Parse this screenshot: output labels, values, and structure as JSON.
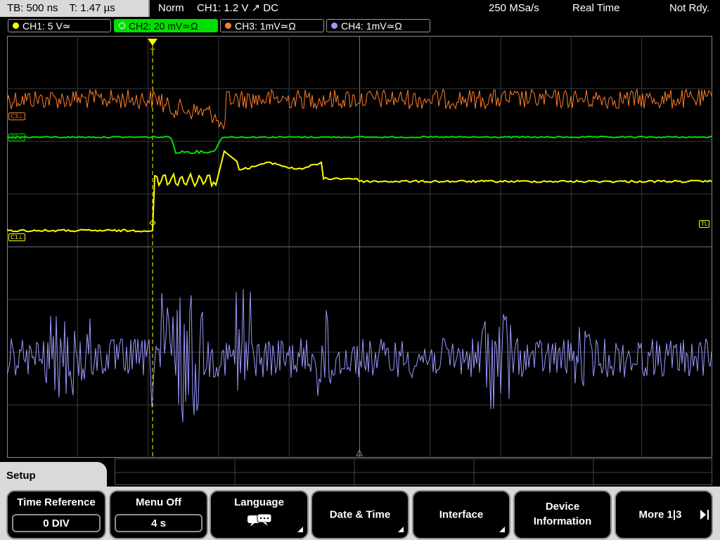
{
  "status": {
    "timebase": "TB: 500 ns",
    "trigger_time": "T: 1.47 µs",
    "mode": "Norm",
    "trigger_info": "CH1: 1.2 V ↗ DC",
    "sample_rate": "250 MSa/s",
    "acq_mode": "Real Time",
    "state": "Not Rdy."
  },
  "channels": [
    {
      "label": "CH1: 5 V≃",
      "color": "#ffff00",
      "active": false
    },
    {
      "label": "CH2: 20 mV≃Ω",
      "color": "#00e000",
      "active": true
    },
    {
      "label": "CH3: 1mV≃Ω",
      "color": "#ff7f27",
      "active": false
    },
    {
      "label": "CH4: 1mV≃Ω",
      "color": "#9999ff",
      "active": false
    }
  ],
  "markers": {
    "c3": "C3⊥",
    "c2": "C2⊥",
    "c1": "C1⊥",
    "tl": "TL"
  },
  "trigger_marker": "T",
  "menu": {
    "title": "Setup",
    "softkeys": [
      {
        "label": "Time Reference",
        "value": "0 DIV"
      },
      {
        "label": "Menu Off",
        "value": "4 s"
      },
      {
        "label": "Language",
        "icon": "speech-bubbles-icon"
      },
      {
        "label": "Date & Time"
      },
      {
        "label": "Interface"
      },
      {
        "label_line1": "Device",
        "label_line2": "Information"
      },
      {
        "label": "More 1|3"
      }
    ]
  }
}
